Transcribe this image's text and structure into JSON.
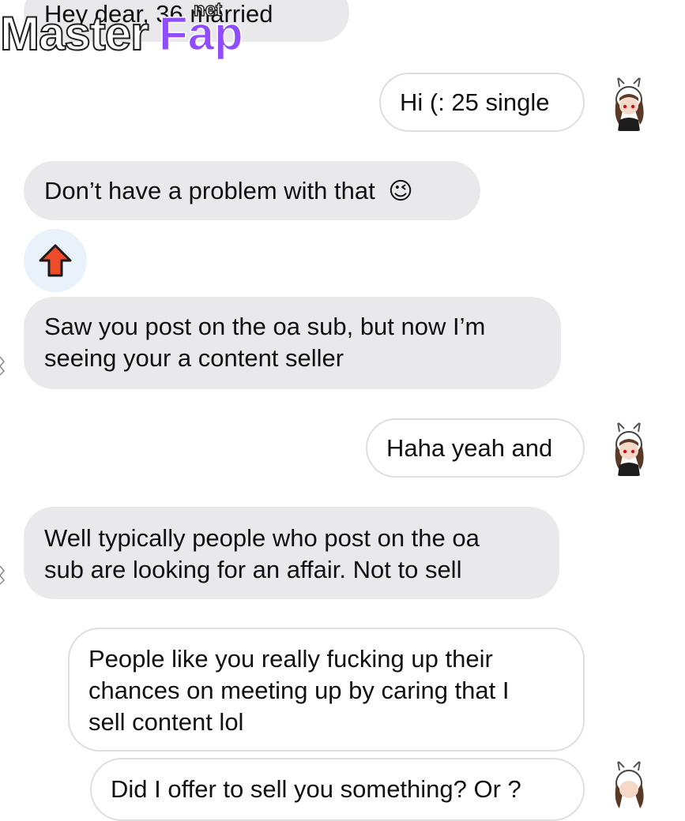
{
  "messages": [
    {
      "text": "Hey dear, 36 married"
    },
    {
      "text": "Hi (: 25 single"
    },
    {
      "text": "Don’t have a problem with that",
      "emoji": "😉"
    },
    {
      "text": "Saw you post on the oa sub, but now I’m"
    },
    {
      "text": "seeing your a content seller"
    },
    {
      "text": "Haha yeah and"
    },
    {
      "text": "Well typically people who post on the oa"
    },
    {
      "text": "sub are looking for an affair. Not to sell"
    },
    {
      "text": "People like you really fucking up their"
    },
    {
      "text": "chances on meeting up by caring that I"
    },
    {
      "text": "sell content lol"
    },
    {
      "text": "Did I offer to sell you something? Or ?"
    }
  ],
  "watermark": {
    "brand_part1": "Master",
    "brand_part2": "Fap",
    "suffix": "net"
  },
  "reaction": {
    "icon": "up-arrow-icon",
    "color": "#ee4b2b"
  },
  "avatar": {
    "icon": "anime-avatar-icon"
  },
  "colors": {
    "incoming_bubble": "#e9e9eb",
    "outgoing_border": "#dedede",
    "reaction_bg": "#e9f1fb"
  }
}
